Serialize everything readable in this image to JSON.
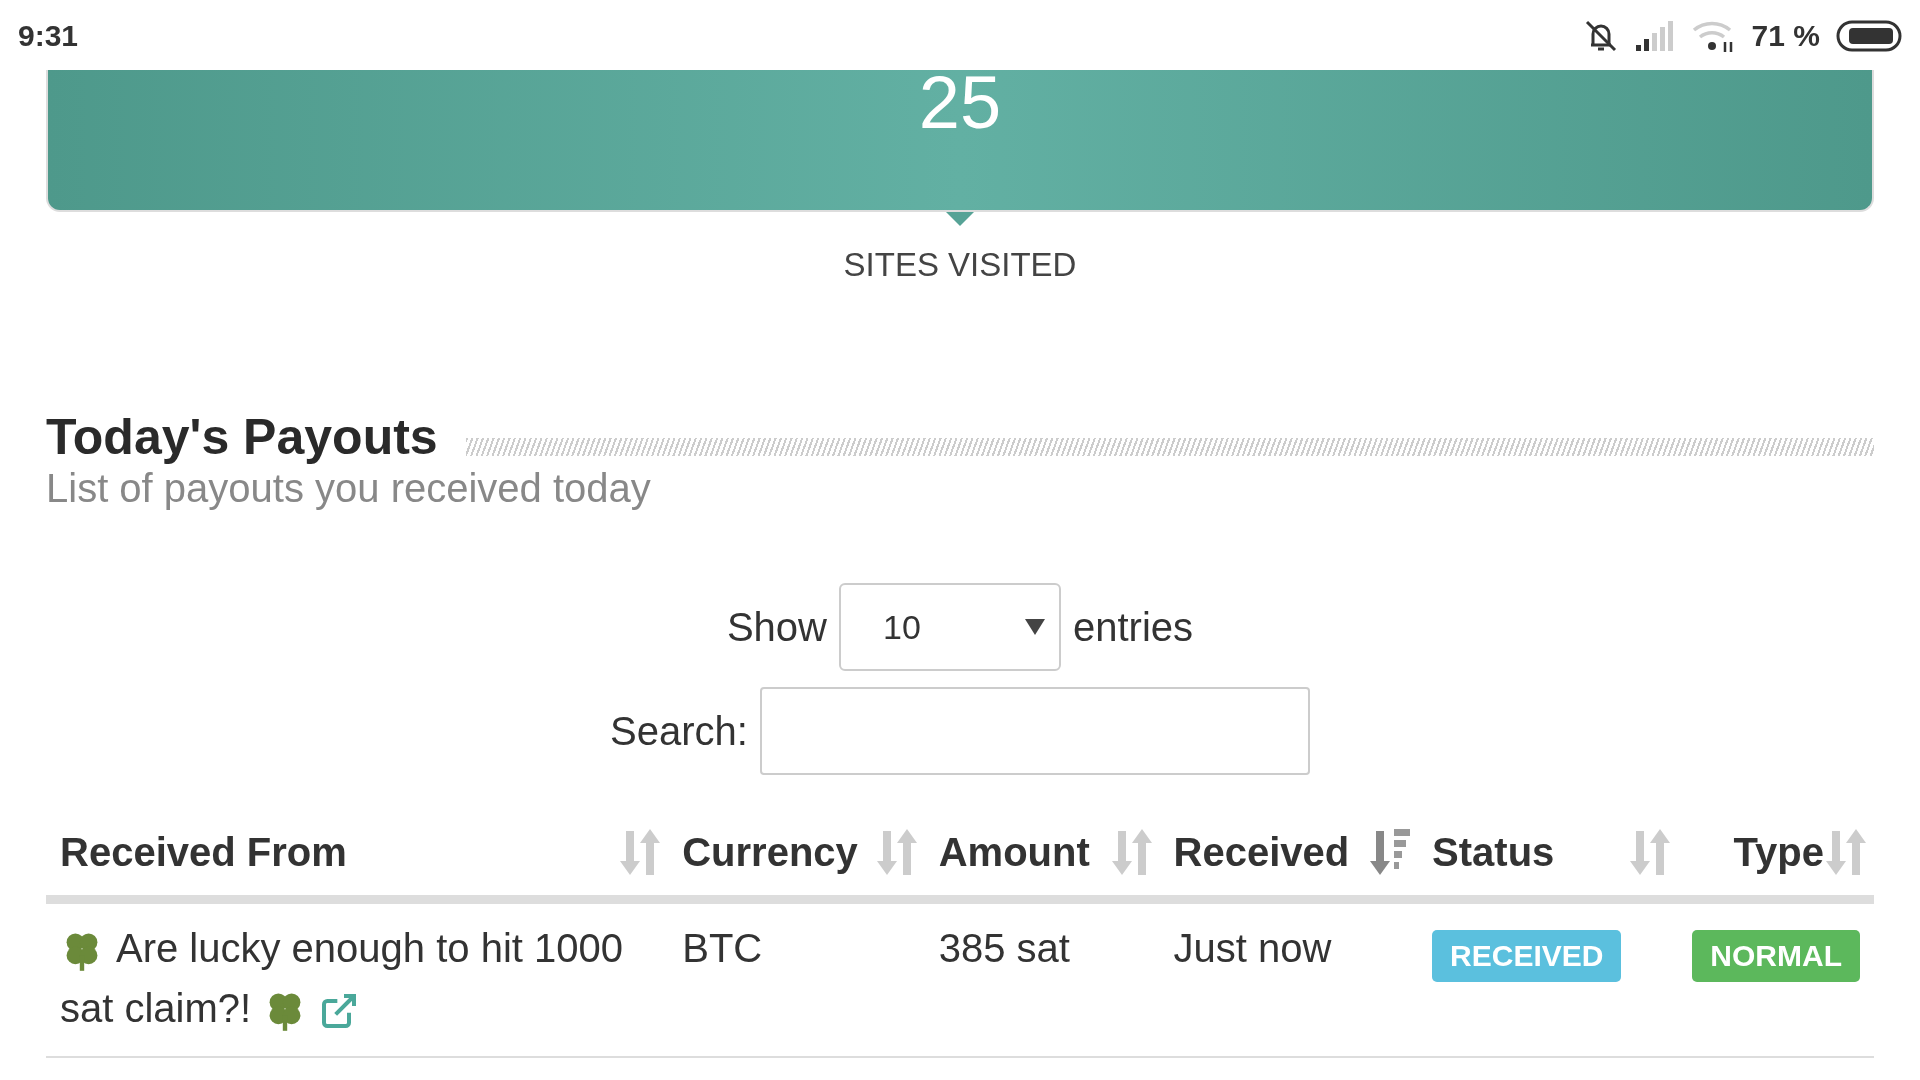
{
  "status_bar": {
    "time": "9:31",
    "battery_text": "71 %"
  },
  "stat_card": {
    "value": "25",
    "label": "SITES VISITED"
  },
  "section": {
    "title": "Today's Payouts",
    "subtitle": "List of payouts you received today"
  },
  "length_control": {
    "before": "Show",
    "value": "10",
    "after": "entries"
  },
  "search": {
    "label": "Search:"
  },
  "table": {
    "columns": [
      {
        "label": "Received From",
        "sorted": false
      },
      {
        "label": "Currency",
        "sorted": false
      },
      {
        "label": "Amount",
        "sorted": false
      },
      {
        "label": "Received",
        "sorted": true
      },
      {
        "label": "Status",
        "sorted": false
      },
      {
        "label": "Type",
        "sorted": false
      }
    ],
    "rows": [
      {
        "source": "Are lucky enough to hit 1000 sat claim?!",
        "currency": "BTC",
        "amount": "385 sat",
        "received": "Just now",
        "status": "RECEIVED",
        "type": "NORMAL",
        "color": "#5cb85c"
      }
    ]
  }
}
